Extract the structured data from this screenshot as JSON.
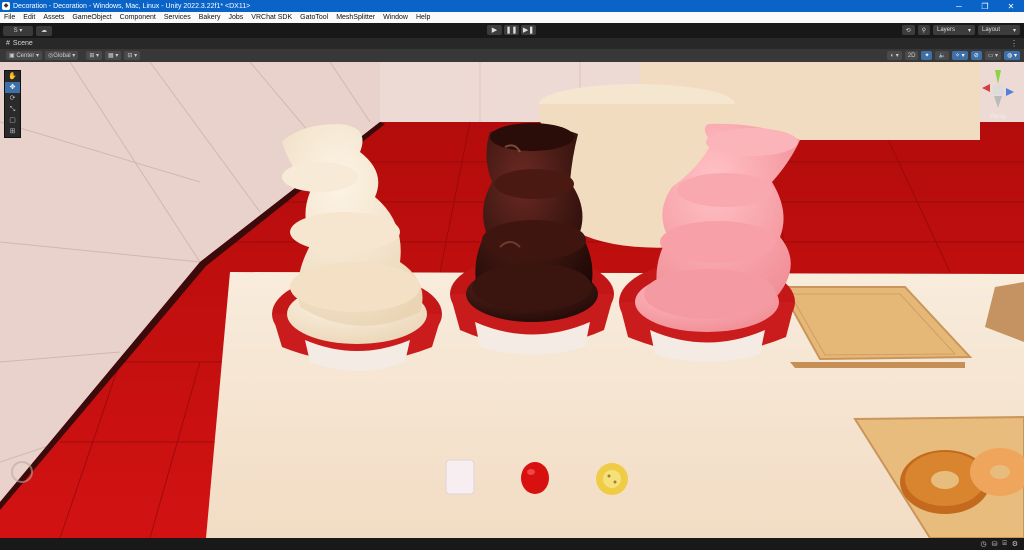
{
  "window": {
    "title": "Decoration - Decoration - Windows, Mac, Linux - Unity 2022.3.22f1* <DX11>",
    "minimize": "─",
    "maximize": "❐",
    "close": "✕"
  },
  "menu": [
    "File",
    "Edit",
    "Assets",
    "GameObject",
    "Component",
    "Services",
    "Bakery",
    "Jobs",
    "VRChat SDK",
    "GatoTool",
    "MeshSplitter",
    "Window",
    "Help"
  ],
  "toolbar": {
    "account": "S ▾",
    "cloud": "☁",
    "play": "▶",
    "pause": "❚❚",
    "step": "▶❚",
    "history": "⟲",
    "search": "⚲",
    "layers": "Layers",
    "layout": "Layout"
  },
  "tabs": {
    "scene": "Scene"
  },
  "scene_toolbar": {
    "pivot": "Center",
    "space": "Global",
    "mode_2d": "2D"
  },
  "gizmo": {
    "label": "Persp"
  },
  "colors": {
    "titlebar": "#0a64c8",
    "floor_red": "#c4100e",
    "chocolate": "#3a1510",
    "strawberry": "#f7a0a8",
    "white_choc": "#f3e2c6"
  }
}
